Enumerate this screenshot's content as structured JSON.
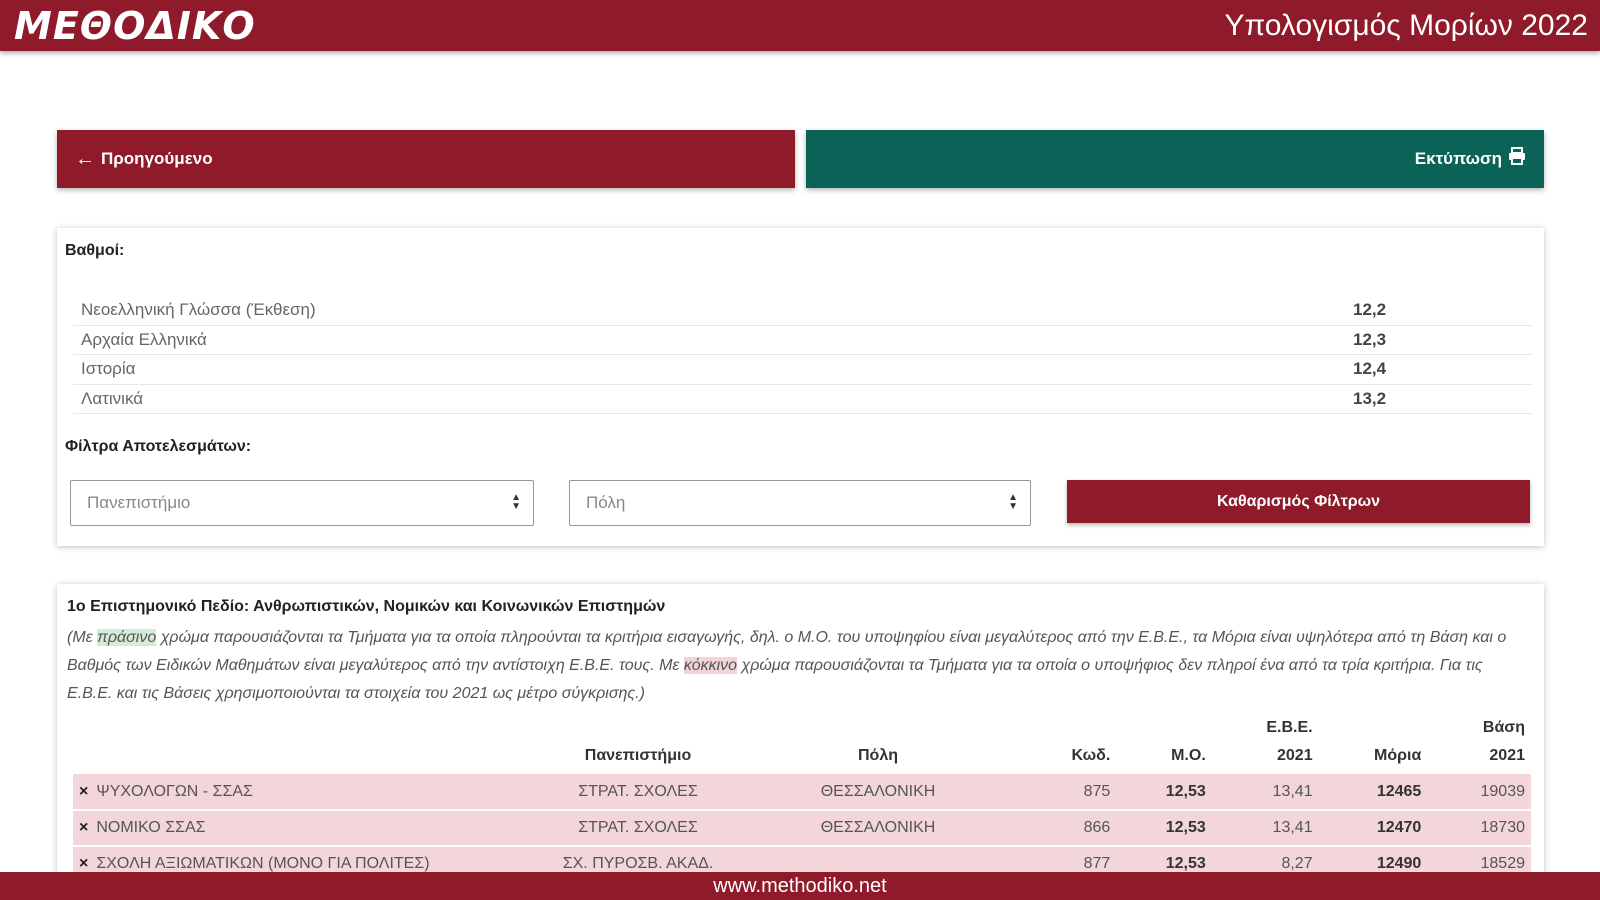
{
  "header": {
    "logo": "ΜΕΘΟΔΙΚΟ",
    "title": "Υπολογισμός Μορίων 2022"
  },
  "nav": {
    "prev_label": "Προηγούμενο",
    "print_label": "Εκτύπωση"
  },
  "grades": {
    "label": "Βαθμοί:",
    "items": [
      {
        "name": "Νεοελληνική Γλώσσα (Έκθεση)",
        "value": "12,2"
      },
      {
        "name": "Αρχαία Ελληνικά",
        "value": "12,3"
      },
      {
        "name": "Ιστορία",
        "value": "12,4"
      },
      {
        "name": "Λατινικά",
        "value": "13,2"
      }
    ]
  },
  "filters": {
    "label": "Φίλτρα Αποτελεσμάτων:",
    "university_placeholder": "Πανεπιστήμιο",
    "city_placeholder": "Πόλη",
    "clear_label": "Καθαρισμός Φίλτρων"
  },
  "field": {
    "title": "1ο Επιστημονικό Πεδίο: Ανθρωπιστικών, Νομικών και Κοινωνικών Επιστημών",
    "note_part1": "(Με ",
    "note_green": "πράσινο",
    "note_part2": " χρώμα παρουσιάζονται τα Τμήματα για τα οποία πληρούνται τα κριτήρια εισαγωγής, δηλ. ο Μ.Ο. του υποψηφίου είναι μεγαλύτερος από την Ε.Β.Ε., τα Μόρια είναι υψηλότερα από τη Βάση και ο Βαθμός των Ειδικών Μαθημάτων είναι μεγαλύτερος από την αντίστοιχη Ε.Β.Ε. τους. Με ",
    "note_red": "κόκκινο",
    "note_part3": " χρώμα παρουσιάζονται τα Τμήματα για τα οποία ο υποψήφιος δεν πληροί ένα από τα τρία κριτήρια. Για τις Ε.Β.Ε. και τις Βάσεις χρησιμοποιούνται τα στοιχεία του 2021 ως μέτρο σύγκρισης.)"
  },
  "table": {
    "columns": {
      "university": "Πανεπιστήμιο",
      "city": "Πόλη",
      "code": "Κωδ.",
      "avg": "Μ.Ο.",
      "ebe_top": "Ε.Β.Ε.",
      "ebe_bottom": "2021",
      "points": "Μόρια",
      "base_top": "Βάση",
      "base_bottom": "2021"
    },
    "rows": [
      {
        "mark": "×",
        "name": "ΨΥΧΟΛΟΓΩΝ - ΣΣΑΣ",
        "university": "ΣΤΡΑΤ. ΣΧΟΛΕΣ",
        "city": "ΘΕΣΣΑΛΟΝΙΚΗ",
        "code": "875",
        "avg": "12,53",
        "ebe": "13,41",
        "points": "12465",
        "base": "19039"
      },
      {
        "mark": "×",
        "name": "ΝΟΜΙΚΟ ΣΣΑΣ",
        "university": "ΣΤΡΑΤ. ΣΧΟΛΕΣ",
        "city": "ΘΕΣΣΑΛΟΝΙΚΗ",
        "code": "866",
        "avg": "12,53",
        "ebe": "13,41",
        "points": "12470",
        "base": "18730"
      },
      {
        "mark": "×",
        "name": "ΣΧΟΛΗ ΑΞΙΩΜΑΤΙΚΩΝ (ΜΟΝΟ ΓΙΑ ΠΟΛΙΤΕΣ)",
        "university": "ΣΧ. ΠΥΡΟΣΒ. ΑΚΑΔ.",
        "city": "",
        "code": "877",
        "avg": "12,53",
        "ebe": "8,27",
        "points": "12490",
        "base": "18529"
      }
    ]
  },
  "footer": {
    "url": "www.methodiko.net"
  },
  "colors": {
    "brand_red": "#8e1a2a",
    "print_green": "#0b6257",
    "row_red": "#f2d6da",
    "highlight_green": "#d3ecd9"
  },
  "icons": {
    "prev": "arrow-left-icon",
    "print": "printer-icon",
    "select": "sort-caret-icon",
    "row_mark": "x-mark-icon"
  }
}
